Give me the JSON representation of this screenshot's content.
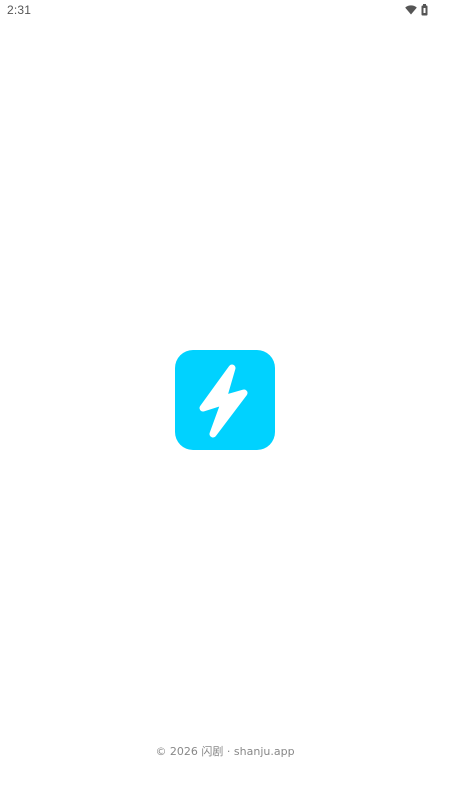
{
  "status_bar": {
    "time": "2:31",
    "icons": [
      "wifi-icon",
      "battery-icon"
    ]
  },
  "splash": {
    "logo_icon": "lightning-bolt-icon",
    "logo_color": "#00d2ff",
    "logo_glyph_color": "#ffffff"
  },
  "footer": {
    "copyright": "© 2026 闪剧 · shanju.app"
  }
}
